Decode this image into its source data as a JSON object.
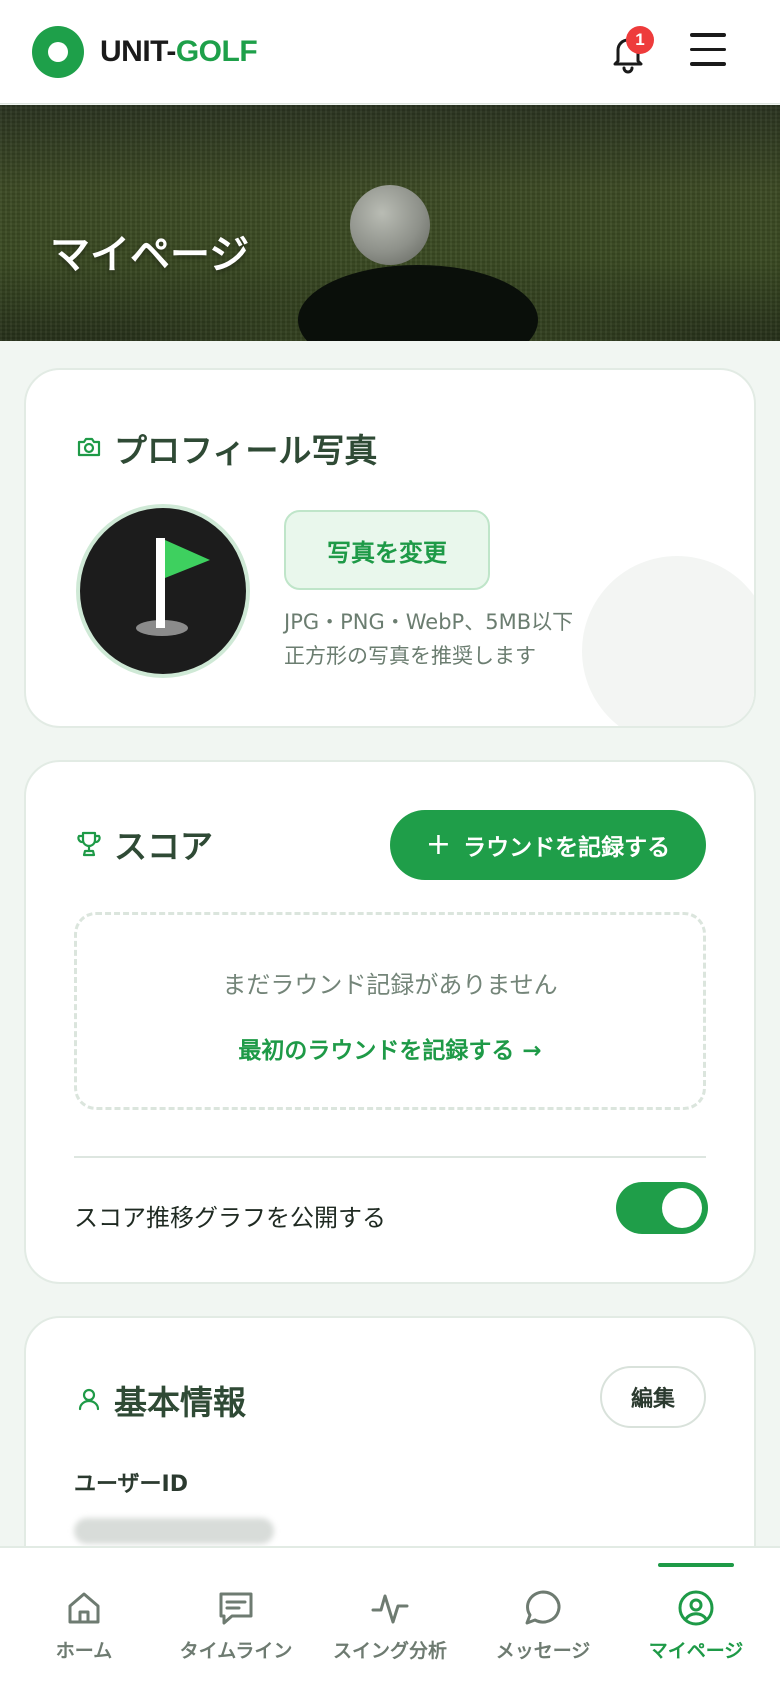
{
  "header": {
    "logo_part1": "UNIT-",
    "logo_part2": "GOLF",
    "notification_count": "1"
  },
  "hero": {
    "title": "マイページ"
  },
  "profile_photo": {
    "title": "プロフィール写真",
    "change_button": "写真を変更",
    "note_line1": "JPG・PNG・WebP、5MB以下",
    "note_line2": "正方形の写真を推奨します"
  },
  "score": {
    "title": "スコア",
    "record_button": "ラウンドを記録する",
    "record_button_icon": "plus-icon",
    "empty_message": "まだラウンド記録がありません",
    "first_round_link": "最初のラウンドを記録する →",
    "public_graph_label": "スコア推移グラフを公開する",
    "public_graph_enabled": true
  },
  "basic_info": {
    "title": "基本情報",
    "edit_button": "編集",
    "user_id_label": "ユーザーID"
  },
  "nav": {
    "items": [
      {
        "label": "ホーム",
        "icon": "home-icon"
      },
      {
        "label": "タイムライン",
        "icon": "timeline-icon"
      },
      {
        "label": "スイング分析",
        "icon": "pulse-icon"
      },
      {
        "label": "メッセージ",
        "icon": "chat-icon"
      },
      {
        "label": "マイページ",
        "icon": "user-circle-icon",
        "active": true
      }
    ]
  },
  "colors": {
    "brand_green": "#1ea04a",
    "badge_red": "#ee3b3b",
    "page_bg": "#f1f6f2"
  }
}
